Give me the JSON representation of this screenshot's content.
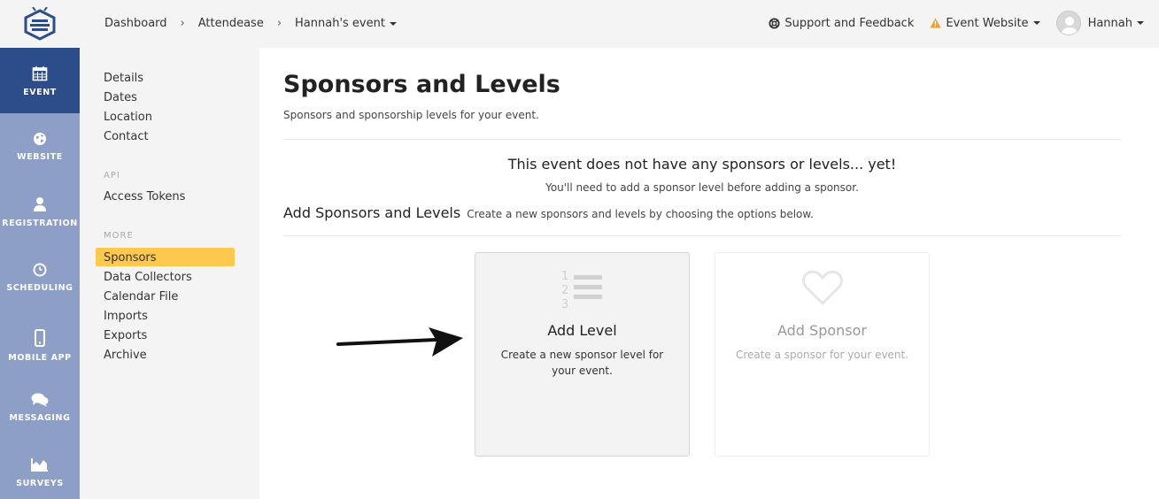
{
  "header": {
    "breadcrumb": [
      "Dashboard",
      "Attendease",
      "Hannah's event"
    ],
    "support_label": "Support and Feedback",
    "website_label": "Event Website",
    "user_name": "Hannah"
  },
  "iconbar": {
    "items": [
      {
        "label": "EVENT",
        "icon": "calendar-icon",
        "active": true
      },
      {
        "label": "WEBSITE",
        "icon": "globe-icon",
        "active": false
      },
      {
        "label": "REGISTRATION",
        "icon": "user-icon",
        "active": false
      },
      {
        "label": "SCHEDULING",
        "icon": "clock-icon",
        "active": false
      },
      {
        "label": "MOBILE APP",
        "icon": "mobile-icon",
        "active": false
      },
      {
        "label": "MESSAGING",
        "icon": "chat-icon",
        "active": false
      },
      {
        "label": "SURVEYS",
        "icon": "area-chart-icon",
        "active": false
      }
    ]
  },
  "subnav": {
    "general": [
      "Details",
      "Dates",
      "Location",
      "Contact"
    ],
    "api_heading": "API",
    "api": [
      "Access Tokens"
    ],
    "more_heading": "MORE",
    "more": [
      "Sponsors",
      "Data Collectors",
      "Calendar File",
      "Imports",
      "Exports",
      "Archive"
    ],
    "active": "Sponsors"
  },
  "main": {
    "title": "Sponsors and Levels",
    "subtitle": "Sponsors and sponsorship levels for your event.",
    "empty_title": "This event does not have any sponsors or levels... yet!",
    "empty_sub": "You'll need to add a sponsor level before adding a sponsor.",
    "add_heading": "Add Sponsors and Levels",
    "add_sub": "Create a new sponsors and levels by choosing the options below.",
    "cards": [
      {
        "title": "Add Level",
        "description": "Create a new sponsor level for your event.",
        "icon": "ordered-list-icon",
        "enabled": true
      },
      {
        "title": "Add Sponsor",
        "description": "Create a sponsor for your event.",
        "icon": "heart-icon",
        "enabled": false
      }
    ]
  },
  "colors": {
    "active_nav": "#2c4d8a",
    "iconbar_bg": "#8d9fc6",
    "highlight": "#fcc84e",
    "warning": "#f0a030"
  }
}
